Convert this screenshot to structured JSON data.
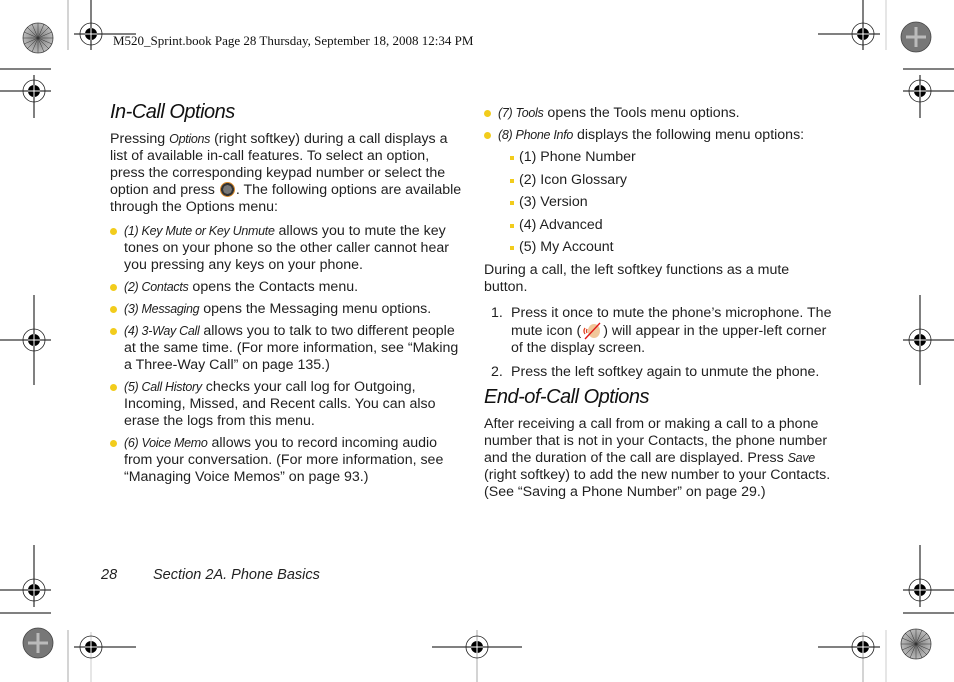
{
  "header": {
    "text": "M520_Sprint.book  Page 28  Thursday, September 18, 2008  12:34 PM"
  },
  "left": {
    "title": "In-Call Options",
    "intro": {
      "pre": "Pressing ",
      "softkey": "Options",
      "mid": " (right softkey) during a call displays a list of available in-call features. To select an option, press the corresponding keypad number or select the option and press ",
      "key_icon": "ok-key-icon",
      "post": ". The following options are available through the Options menu:"
    },
    "bullets": [
      {
        "label": "(1) Key Mute or Key Unmute",
        "text": " allows you to mute the key tones on your phone so the other caller cannot hear you pressing any keys on your phone."
      },
      {
        "label": "(2) Contacts",
        "text": " opens the Contacts menu."
      },
      {
        "label": "(3) Messaging",
        "text": " opens the Messaging menu options."
      },
      {
        "label": "(4) 3-Way Call",
        "text": " allows you to talk to two different people at the same time. (For more information, see “Making a Three-Way Call” on page 135.)"
      },
      {
        "label": "(5) Call History",
        "text": " checks your call log for Outgoing, Incoming, Missed, and Recent calls. You can also erase the logs from this menu."
      },
      {
        "label": "(6) Voice Memo",
        "text": " allows you to record incoming audio from your conversation. (For more information, see “Managing Voice Memos” on page 93.)"
      }
    ]
  },
  "right": {
    "bullets": [
      {
        "label": "(7) Tools",
        "text": " opens the Tools menu options."
      },
      {
        "label": "(8) Phone Info",
        "text": " displays the following menu options:"
      }
    ],
    "sub_items": [
      "(1) Phone Number",
      "(2) Icon Glossary",
      "(3) Version",
      "(4) Advanced",
      "(5) My Account"
    ],
    "mute_para": "During a call, the left softkey functions as a mute button.",
    "steps": [
      {
        "num": "1.",
        "pre": "Press it once to mute the phone’s microphone. The mute icon (",
        "icon": "mute-icon",
        "post": ") will appear in the upper-left corner of the display screen."
      },
      {
        "num": "2.",
        "text": "Press the left softkey again to unmute the phone."
      }
    ],
    "end_title": "End-of-Call Options",
    "end_para": {
      "pre": "After receiving a call from or making a call to a phone number that is not in your Contacts, the phone number and the duration of the call are displayed. Press ",
      "softkey": "Save",
      "post": " (right softkey) to add the new number to your Contacts. (See “Saving a Phone Number” on page 29.)"
    }
  },
  "footer": {
    "page_number": "28",
    "section": "Section 2A. Phone Basics"
  },
  "colors": {
    "bullet": "#f2cc1c",
    "text": "#1f1f1f"
  }
}
